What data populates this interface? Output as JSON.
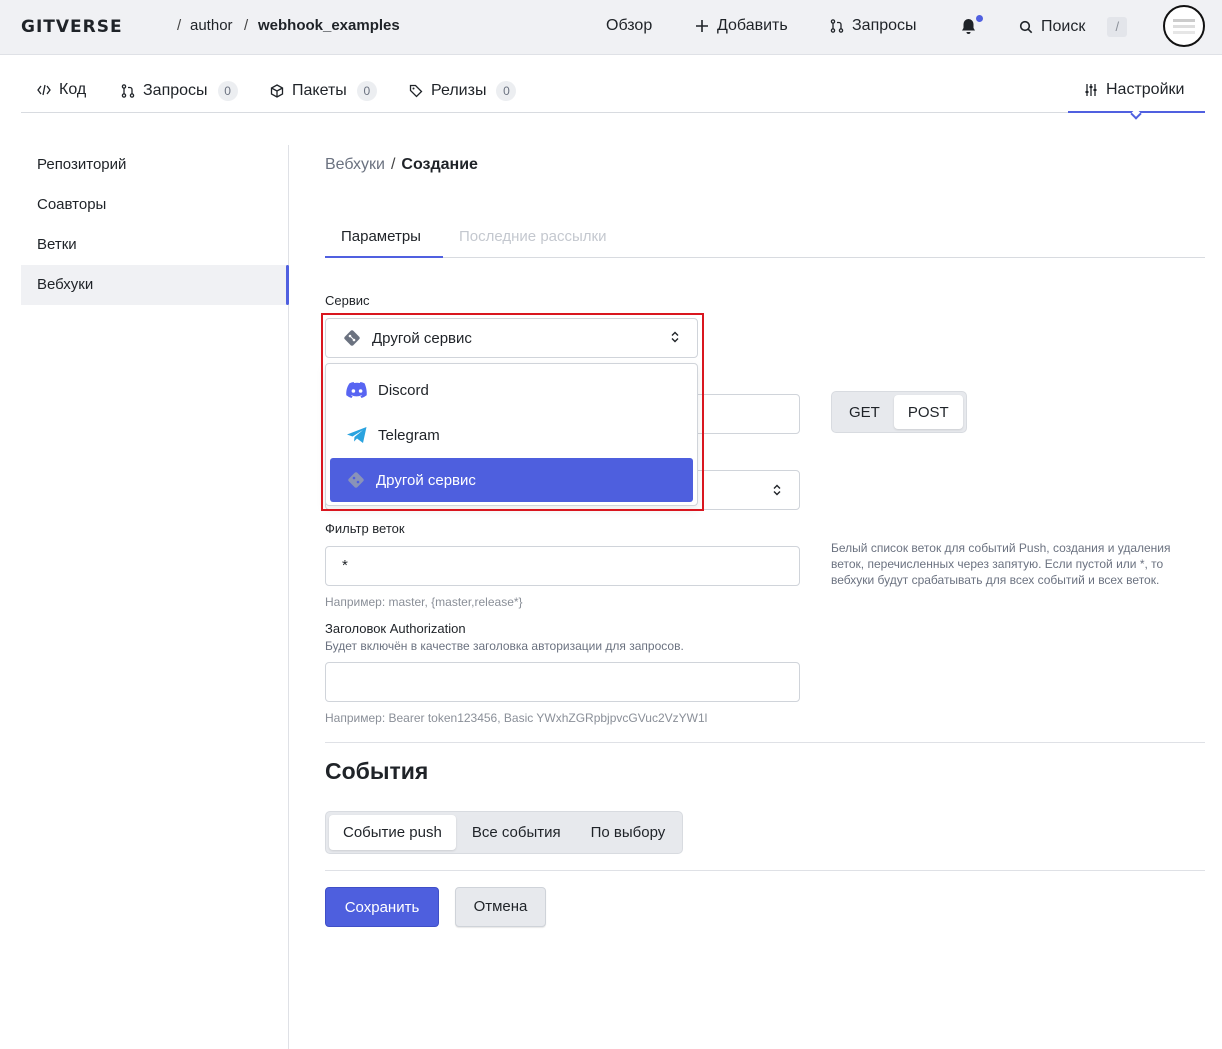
{
  "header": {
    "logo": "GITVERSE",
    "breadcrumb_sep": "/",
    "owner": "author",
    "repo": "webhook_examples",
    "nav": {
      "overview": "Обзор",
      "add": "Добавить",
      "requests": "Запросы",
      "search": "Поиск",
      "search_shortcut": "/"
    }
  },
  "repo_tabs": {
    "code": "Код",
    "requests": "Запросы",
    "requests_count": "0",
    "packages": "Пакеты",
    "packages_count": "0",
    "releases": "Релизы",
    "releases_count": "0",
    "settings": "Настройки"
  },
  "sidebar": {
    "items": [
      {
        "label": "Репозиторий"
      },
      {
        "label": "Соавторы"
      },
      {
        "label": "Ветки"
      },
      {
        "label": "Вебхуки"
      }
    ]
  },
  "breadcrumb": {
    "parent": "Вебхуки",
    "sep": "/",
    "current": "Создание"
  },
  "subtabs": {
    "params": "Параметры",
    "deliveries": "Последние рассылки"
  },
  "form": {
    "service_label": "Сервис",
    "service_value": "Другой сервис",
    "service_options": [
      "Discord",
      "Telegram",
      "Другой сервис"
    ],
    "method_options": [
      "GET",
      "POST"
    ],
    "method_selected": "POST",
    "branch_filter_label": "Фильтр веток",
    "branch_filter_value": "*",
    "branch_filter_hint": "Например: master, {master,release*}",
    "branch_filter_help": "Белый список веток для событий Push, создания и удаления веток, перечисленных через запятую. Если пустой или *, то вебхуки будут срабатывать для всех событий и всех веток.",
    "auth_label": "Заголовок Authorization",
    "auth_desc": "Будет включён в качестве заголовка авторизации для запросов.",
    "auth_value": "",
    "auth_hint": "Например: Bearer token123456, Basic YWxhZGRpbjpvcGVuc2VzYW1l"
  },
  "events": {
    "title": "События",
    "options": [
      "Событие push",
      "Все события",
      "По выбору"
    ],
    "selected": "Событие push"
  },
  "actions": {
    "save": "Сохранить",
    "cancel": "Отмена"
  },
  "colors": {
    "accent": "#4e5fde",
    "focus_ring": "#d9161f",
    "discord": "#5865f2",
    "telegram": "#2aa3df"
  }
}
